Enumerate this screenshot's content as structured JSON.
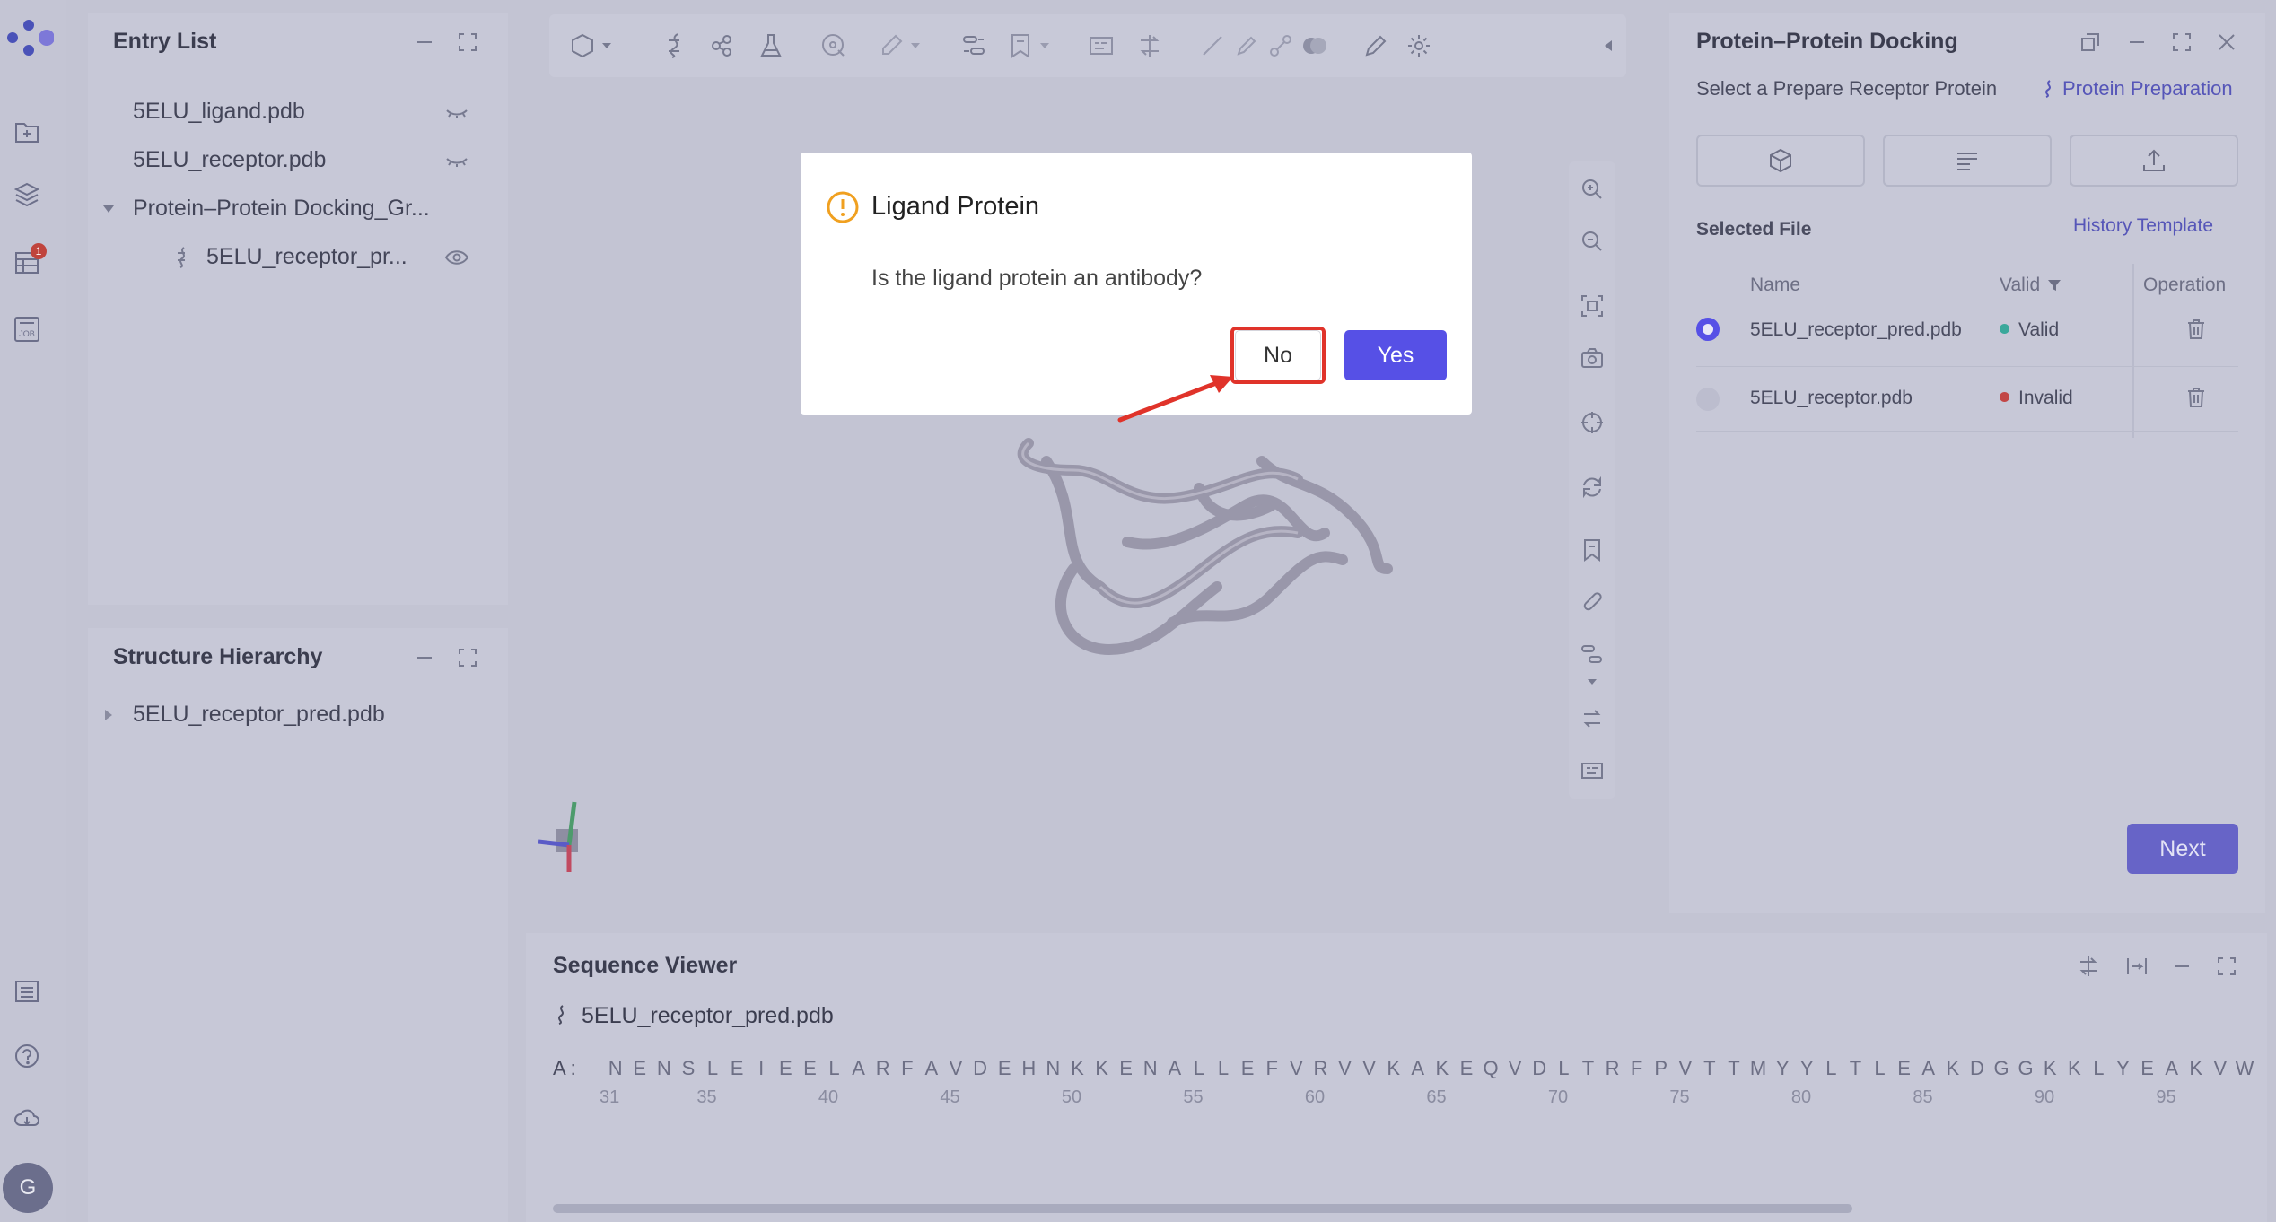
{
  "rail": {
    "avatar_letter": "G",
    "notification_count": "1"
  },
  "entry_list": {
    "title": "Entry List",
    "items": [
      {
        "label": "5ELU_ligand.pdb"
      },
      {
        "label": "5ELU_receptor.pdb"
      },
      {
        "label": "Protein–Protein Docking_Gr..."
      },
      {
        "label": "5ELU_receptor_pr..."
      }
    ]
  },
  "structure_hierarchy": {
    "title": "Structure Hierarchy",
    "items": [
      {
        "label": "5ELU_receptor_pred.pdb"
      }
    ]
  },
  "docking": {
    "title": "Protein–Protein Docking",
    "select_label": "Select a Prepare Receptor Protein",
    "prep_link": "Protein Preparation",
    "selected_file_label": "Selected File",
    "history_link": "History Template",
    "columns": {
      "name": "Name",
      "valid": "Valid",
      "operation": "Operation"
    },
    "rows": [
      {
        "name": "5ELU_receptor_pred.pdb",
        "status": "Valid",
        "status_color": "#3aa89b",
        "selected": true
      },
      {
        "name": "5ELU_receptor.pdb",
        "status": "Invalid",
        "status_color": "#c24646",
        "selected": false
      }
    ],
    "next_label": "Next"
  },
  "sequence": {
    "title": "Sequence Viewer",
    "file": "5ELU_receptor_pred.pdb",
    "chain_label": "A :",
    "residues": "NENSLEIEELARFAVDEHNKKENALLEFVRVVKAKEQVDLTRFPVTTMYYLTLEAKDGGKKLYEAKVW",
    "ticks": [
      "31",
      "35",
      "40",
      "45",
      "50",
      "55",
      "60",
      "65",
      "70",
      "75",
      "80",
      "85",
      "90",
      "95"
    ]
  },
  "dialog": {
    "title": "Ligand Protein",
    "message": "Is the ligand protein an antibody?",
    "no_label": "No",
    "yes_label": "Yes",
    "accent_color": "#5650e6",
    "warning_color": "#f0a020",
    "highlight_color": "#e0332a"
  }
}
